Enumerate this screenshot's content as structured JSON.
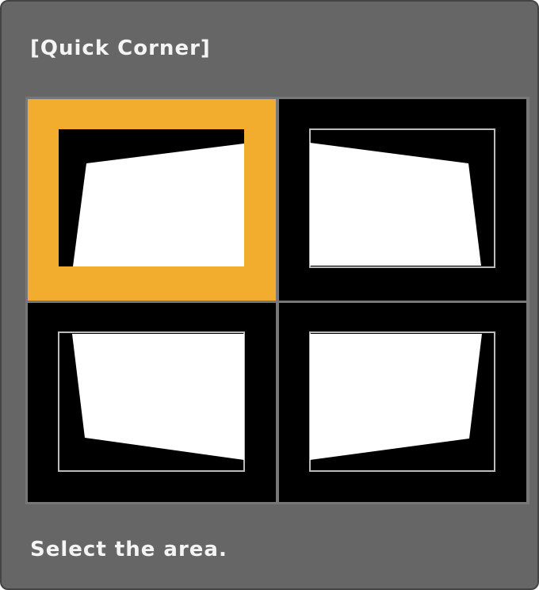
{
  "dialog": {
    "title": "[Quick Corner]",
    "instruction": "Select the area."
  },
  "areas": [
    {
      "id": "top-left",
      "selected": true
    },
    {
      "id": "top-right",
      "selected": false
    },
    {
      "id": "bottom-left",
      "selected": false
    },
    {
      "id": "bottom-right",
      "selected": false
    }
  ],
  "colors": {
    "panel_background": "#666666",
    "selection_highlight": "#f2ac2e",
    "cell_background": "#000000",
    "image_shape": "#ffffff",
    "frame_outline": "#bbbbbb"
  }
}
